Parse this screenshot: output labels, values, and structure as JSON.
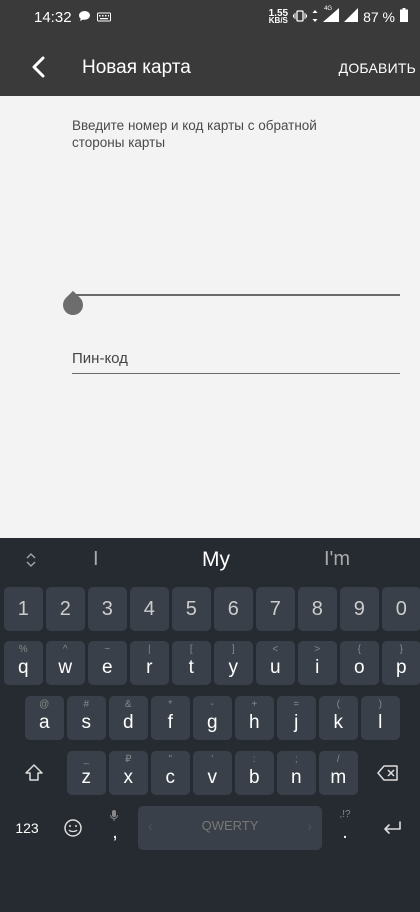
{
  "status": {
    "time": "14:32",
    "speed_value": "1.55",
    "speed_unit": "KB/S",
    "network": "4G",
    "battery": "87 %"
  },
  "appbar": {
    "title": "Новая карта",
    "action": "ДОБАВИТЬ",
    "back_icon": "back-arrow-icon"
  },
  "form": {
    "hint": "Введите номер и код карты с обратной стороны карты",
    "card_number_value": "",
    "pin_placeholder": "Пин-код"
  },
  "keyboard": {
    "suggestions": [
      "I",
      "My",
      "I'm"
    ],
    "numbers": [
      "1",
      "2",
      "3",
      "4",
      "5",
      "6",
      "7",
      "8",
      "9",
      "0"
    ],
    "row1": [
      {
        "k": "q",
        "s": "%"
      },
      {
        "k": "w",
        "s": "^"
      },
      {
        "k": "e",
        "s": "~"
      },
      {
        "k": "r",
        "s": "|"
      },
      {
        "k": "t",
        "s": "["
      },
      {
        "k": "y",
        "s": "]"
      },
      {
        "k": "u",
        "s": "<"
      },
      {
        "k": "i",
        "s": ">"
      },
      {
        "k": "o",
        "s": "{"
      },
      {
        "k": "p",
        "s": "}"
      }
    ],
    "row2": [
      {
        "k": "a",
        "s": "@"
      },
      {
        "k": "s",
        "s": "#"
      },
      {
        "k": "d",
        "s": "&"
      },
      {
        "k": "f",
        "s": "*"
      },
      {
        "k": "g",
        "s": "-"
      },
      {
        "k": "h",
        "s": "+"
      },
      {
        "k": "j",
        "s": "="
      },
      {
        "k": "k",
        "s": "("
      },
      {
        "k": "l",
        "s": ")"
      }
    ],
    "row3": [
      {
        "k": "z",
        "s": "_"
      },
      {
        "k": "x",
        "s": "₽"
      },
      {
        "k": "c",
        "s": "\""
      },
      {
        "k": "v",
        "s": "'"
      },
      {
        "k": "b",
        "s": ":"
      },
      {
        "k": "n",
        "s": ";"
      },
      {
        "k": "m",
        "s": "/"
      }
    ],
    "mode_label": "123",
    "comma": ",",
    "space_label": "QWERTY",
    "period": ".",
    "period_sub": ",!?"
  }
}
